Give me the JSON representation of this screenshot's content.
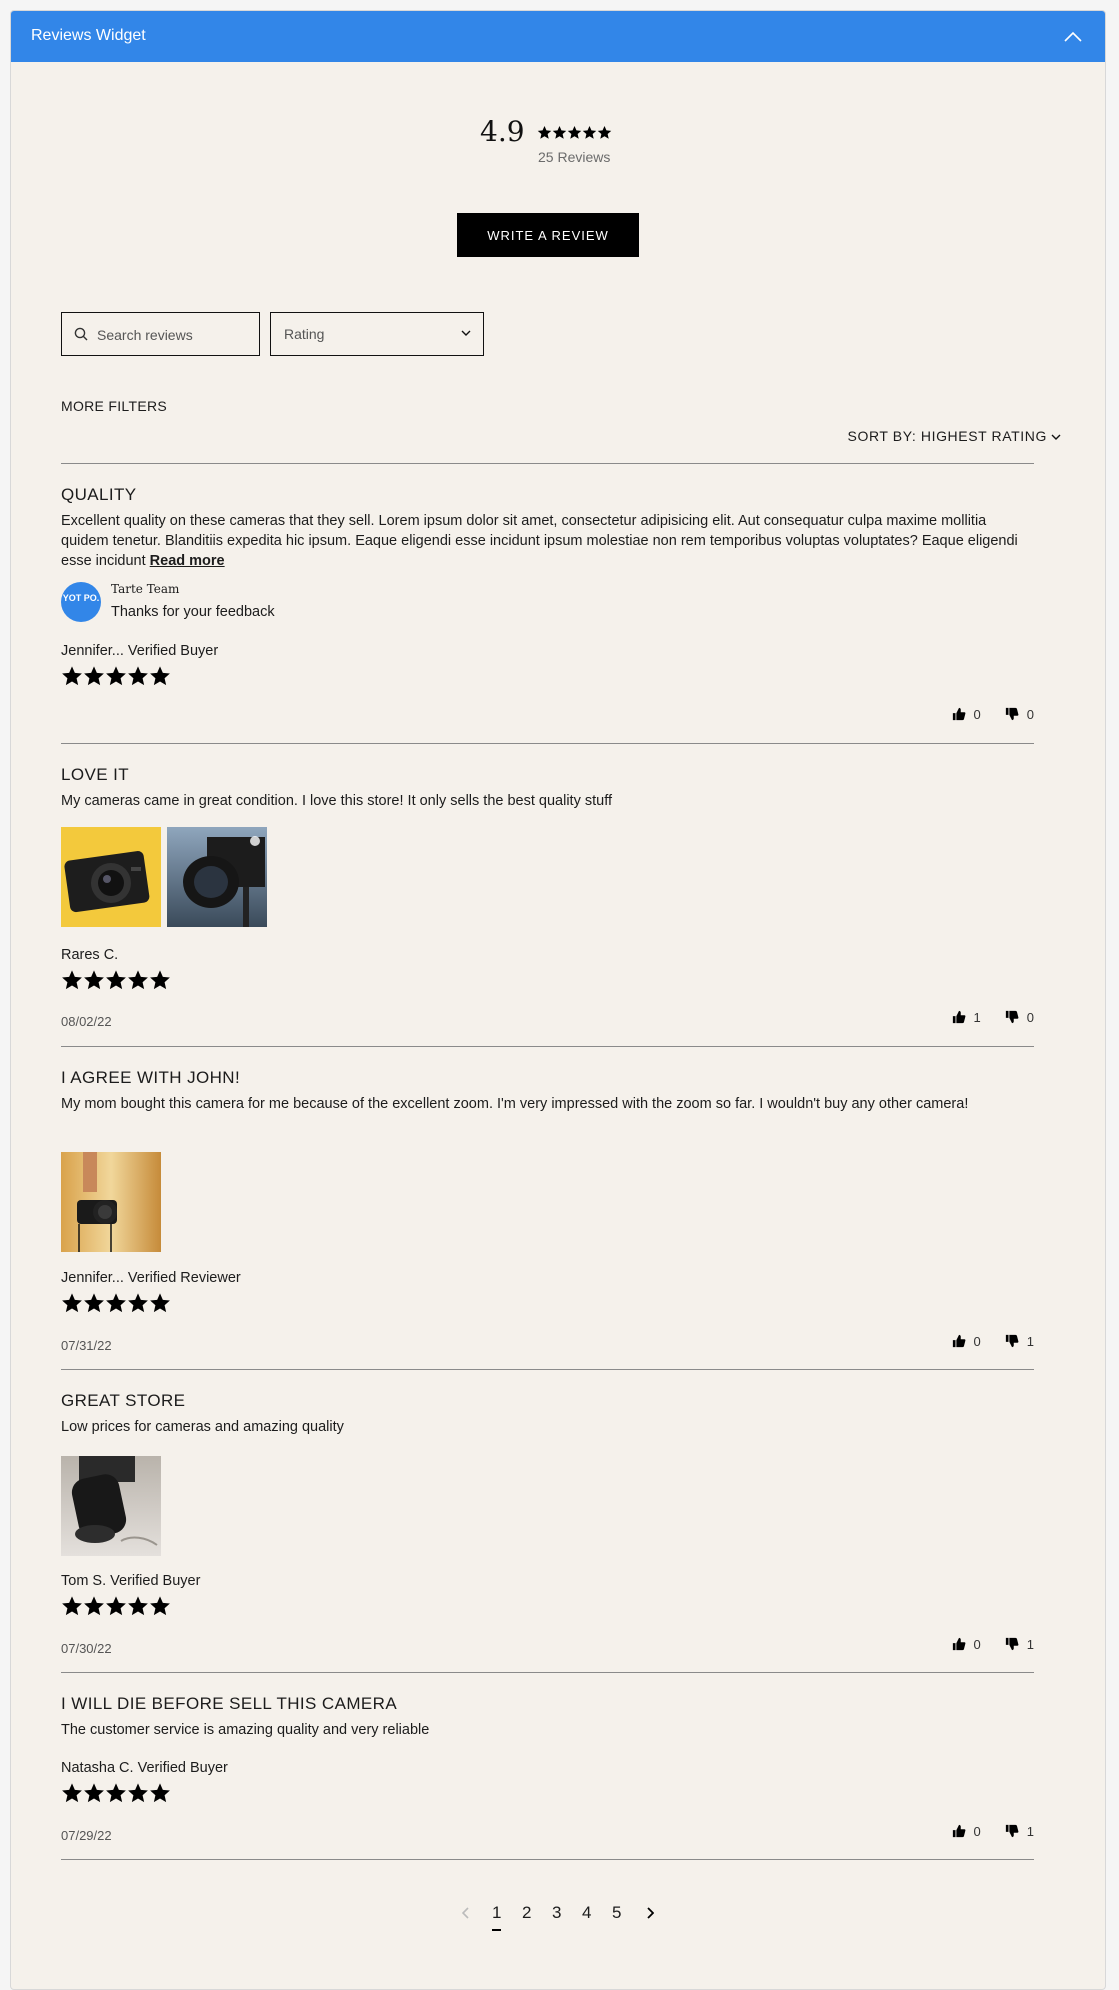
{
  "widget": {
    "title": "Reviews Widget"
  },
  "summary": {
    "average": "4.9",
    "count_label": "25 Reviews",
    "rating": 5
  },
  "actions": {
    "write_review": "WRITE A REVIEW"
  },
  "filters": {
    "search_placeholder": "Search reviews",
    "rating_label": "Rating",
    "more_filters": "MORE FILTERS",
    "sort_label": "SORT BY: HIGHEST RATING"
  },
  "reviews": [
    {
      "title": "QUALITY",
      "body": "Excellent quality on these cameras that they sell. Lorem ipsum dolor sit amet, consectetur adipisicing elit. Aut consequatur culpa maxime mollitia quidem tenetur. Blanditiis expedita hic ipsum. Eaque eligendi esse incidunt ipsum molestiae non rem temporibus voluptas voluptates?  Eaque eligendi esse incidunt ",
      "read_more": "Read more",
      "reply_team": "Tarte Team",
      "reply_text": "Thanks for your feedback",
      "reply_logo": "YOT PO.",
      "author": "Jennifer...",
      "badge": "Verified Buyer",
      "rating": 5,
      "date": "",
      "up": "0",
      "down": "0"
    },
    {
      "title": "LOVE IT",
      "body": "My cameras came in great condition. I love this store! It only sells the best quality stuff",
      "author": "Rares C.",
      "badge": "",
      "rating": 5,
      "date": "08/02/22",
      "up": "1",
      "down": "0"
    },
    {
      "title": "I AGREE WITH JOHN!",
      "body": "My mom bought this camera for me because of the excellent zoom. I'm very impressed with the zoom so far. I wouldn't buy any other camera!",
      "author": "Jennifer...",
      "badge": "Verified Reviewer",
      "rating": 5,
      "date": "07/31/22",
      "up": "0",
      "down": "1"
    },
    {
      "title": "GREAT STORE",
      "body": "Low prices for cameras and amazing quality",
      "author": "Tom S.",
      "badge": "Verified Buyer",
      "rating": 5,
      "date": "07/30/22",
      "up": "0",
      "down": "1"
    },
    {
      "title": "I WILL DIE BEFORE SELL THIS CAMERA",
      "body": "The customer service is amazing quality and very reliable",
      "author": "Natasha C.",
      "badge": "Verified Buyer",
      "rating": 5,
      "date": "07/29/22",
      "up": "0",
      "down": "1"
    }
  ],
  "pagination": {
    "pages": [
      "1",
      "2",
      "3",
      "4",
      "5"
    ],
    "current": "1"
  },
  "colors": {
    "header": "#3286e8",
    "background": "#f5f1eb",
    "button": "#000000"
  }
}
